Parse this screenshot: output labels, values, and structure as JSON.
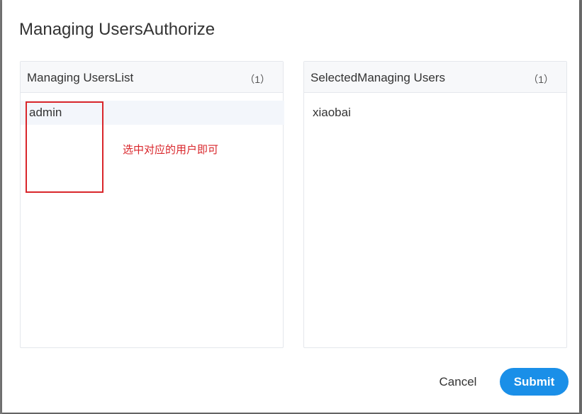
{
  "dialog": {
    "title": "Managing UsersAuthorize"
  },
  "left_panel": {
    "title": "Managing UsersList",
    "count": "（1）",
    "items": [
      "admin"
    ]
  },
  "right_panel": {
    "title": "SelectedManaging Users",
    "count": "（1）",
    "items": [
      "xiaobai"
    ]
  },
  "annotation": {
    "text": "选中对应的用户即可",
    "color": "#d9262b"
  },
  "footer": {
    "cancel_label": "Cancel",
    "submit_label": "Submit"
  },
  "colors": {
    "primary": "#1a8fe8",
    "highlight": "#d9262b"
  }
}
